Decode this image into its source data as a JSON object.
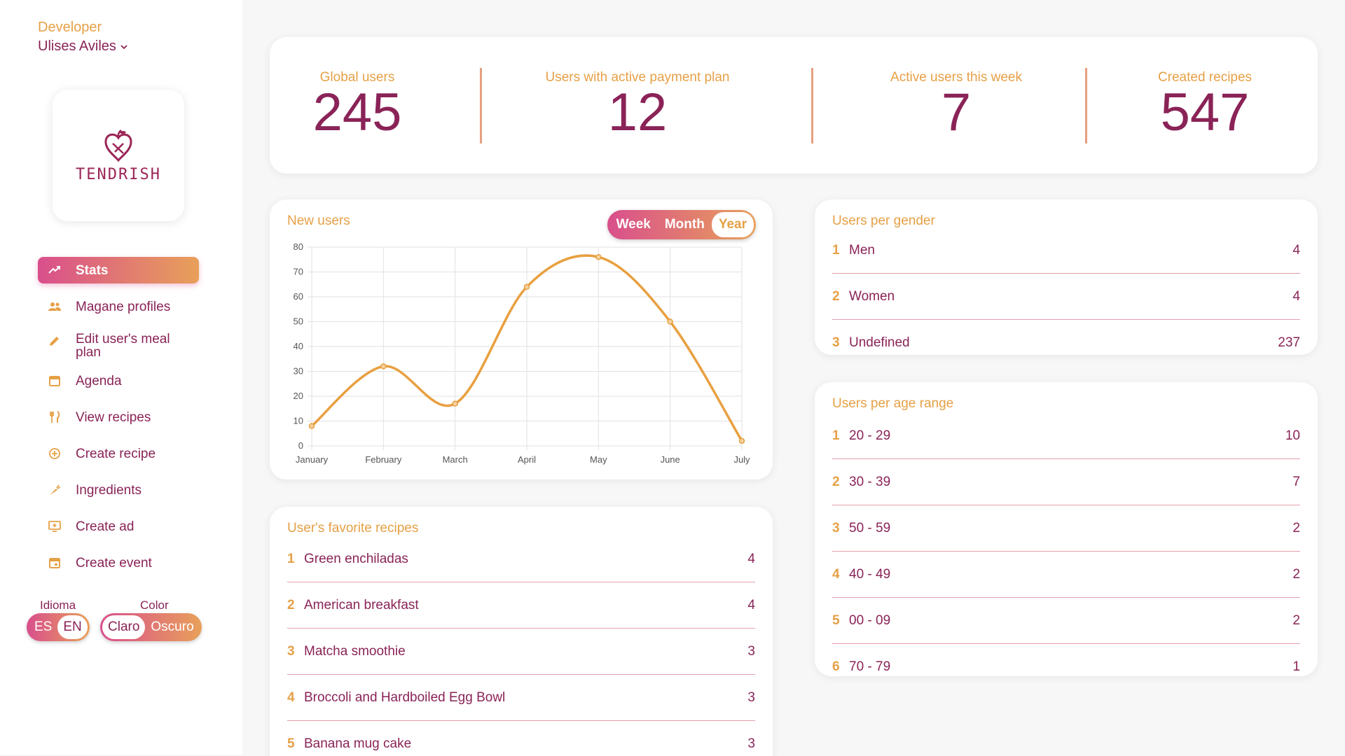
{
  "user": {
    "role": "Developer",
    "name": "Ulises Aviles"
  },
  "logo": {
    "text": "TENDRISH"
  },
  "nav": [
    {
      "label": "Stats",
      "icon": "trending-up-icon",
      "active": true
    },
    {
      "label": "Magane profiles",
      "icon": "people-icon"
    },
    {
      "label": "Edit user's meal plan",
      "icon": "pencil-icon"
    },
    {
      "label": "Agenda",
      "icon": "calendar-icon"
    },
    {
      "label": "View recipes",
      "icon": "fork-knife-icon"
    },
    {
      "label": "Create recipe",
      "icon": "plus-circle-icon"
    },
    {
      "label": "Ingredients",
      "icon": "carrot-icon"
    },
    {
      "label": "Create ad",
      "icon": "monitor-plus-icon"
    },
    {
      "label": "Create event",
      "icon": "calendar-event-icon"
    }
  ],
  "language": {
    "label": "Idioma",
    "options": [
      "ES",
      "EN"
    ],
    "selected": "EN"
  },
  "theme": {
    "label": "Color",
    "options": [
      "Claro",
      "Oscuro"
    ],
    "selected": "Claro"
  },
  "stats": [
    {
      "label": "Global users",
      "value": "245"
    },
    {
      "label": "Users with active payment plan",
      "value": "12"
    },
    {
      "label": "Active users this week",
      "value": "7"
    },
    {
      "label": "Created recipes",
      "value": "547"
    }
  ],
  "new_users": {
    "title": "New users",
    "periods": [
      "Week",
      "Month",
      "Year"
    ],
    "selected_period": "Year"
  },
  "chart_data": {
    "type": "line",
    "title": "",
    "categories": [
      "January",
      "February",
      "March",
      "April",
      "May",
      "June",
      "July"
    ],
    "series": [
      {
        "values": [
          8,
          32,
          17,
          64,
          76,
          50,
          2
        ]
      }
    ],
    "ylim": [
      0,
      80
    ],
    "yticks": [
      0,
      10,
      20,
      30,
      40,
      50,
      60,
      70,
      80
    ],
    "grid": true,
    "line_color": "#e8a040"
  },
  "favorite_recipes": {
    "title": "User's favorite recipes",
    "items": [
      {
        "rank": "1",
        "name": "Green enchiladas",
        "count": "4"
      },
      {
        "rank": "2",
        "name": "American breakfast",
        "count": "4"
      },
      {
        "rank": "3",
        "name": "Matcha smoothie",
        "count": "3"
      },
      {
        "rank": "4",
        "name": "Broccoli and Hardboiled Egg Bowl",
        "count": "3"
      },
      {
        "rank": "5",
        "name": "Banana mug cake",
        "count": "3"
      }
    ]
  },
  "gender": {
    "title": "Users per gender",
    "items": [
      {
        "rank": "1",
        "name": "Men",
        "count": "4"
      },
      {
        "rank": "2",
        "name": "Women",
        "count": "4"
      },
      {
        "rank": "3",
        "name": "Undefined",
        "count": "237"
      }
    ]
  },
  "age": {
    "title": "Users per age range",
    "items": [
      {
        "rank": "1",
        "name": "20 - 29",
        "count": "10"
      },
      {
        "rank": "2",
        "name": "30 - 39",
        "count": "7"
      },
      {
        "rank": "3",
        "name": "50 - 59",
        "count": "2"
      },
      {
        "rank": "4",
        "name": "40 - 49",
        "count": "2"
      },
      {
        "rank": "5",
        "name": "00 - 09",
        "count": "2"
      },
      {
        "rank": "6",
        "name": "70 - 79",
        "count": "1"
      }
    ]
  },
  "colors": {
    "accent_pink": "#d94f8c",
    "accent_orange": "#e8a05a",
    "text_primary": "#8a2357",
    "label_orange": "#e6a046"
  }
}
